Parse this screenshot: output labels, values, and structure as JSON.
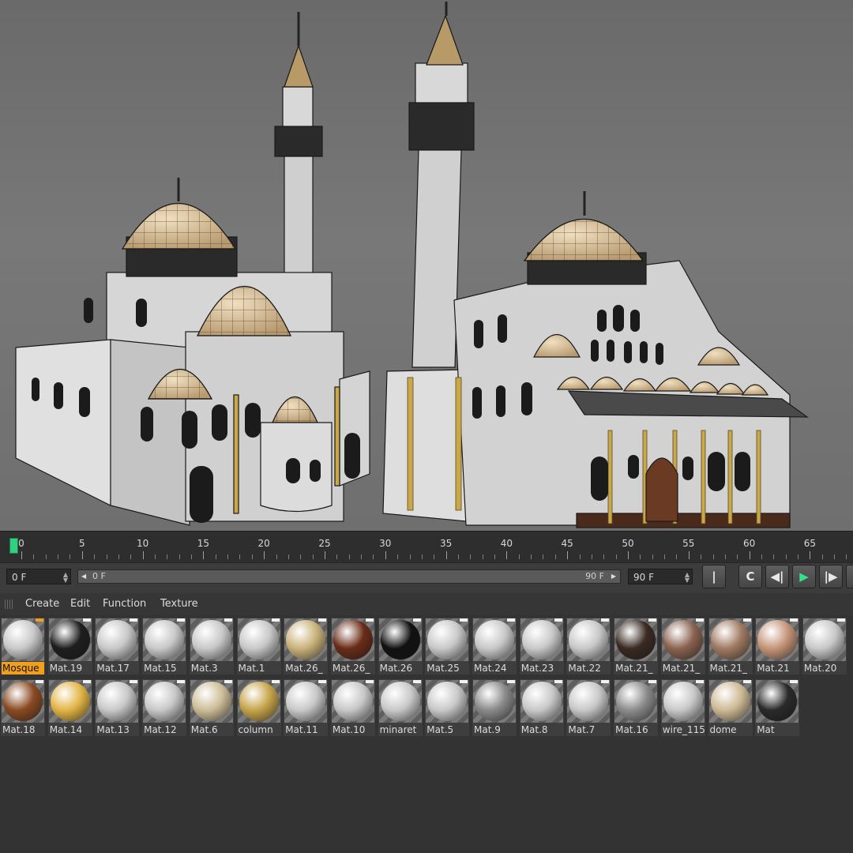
{
  "timeline": {
    "ticks": [
      "0",
      "5",
      "10",
      "15",
      "20",
      "25",
      "30",
      "35",
      "40",
      "45",
      "50",
      "55",
      "60",
      "65"
    ],
    "current_frame": 0
  },
  "transport": {
    "current_field": "0 F",
    "range_start": "0 F",
    "range_end": "90 F",
    "end_field": "90 F"
  },
  "material_menu": {
    "items": [
      "Create",
      "Edit",
      "Function",
      "Texture"
    ]
  },
  "materials": {
    "row1": [
      {
        "name": "Mosque",
        "color": "#c8c8c8",
        "selected": true
      },
      {
        "name": "Mat.19",
        "color": "#1e1e1e"
      },
      {
        "name": "Mat.17",
        "color": "#c8c8c8"
      },
      {
        "name": "Mat.15",
        "color": "#c8c8c8"
      },
      {
        "name": "Mat.3",
        "color": "#c8c8c8"
      },
      {
        "name": "Mat.1",
        "color": "#c8c8c8"
      },
      {
        "name": "Mat.26_",
        "color": "#c9b27a"
      },
      {
        "name": "Mat.26_",
        "color": "#6a2c18"
      },
      {
        "name": "Mat.26",
        "color": "#111111"
      },
      {
        "name": "Mat.25",
        "color": "#c8c8c8"
      },
      {
        "name": "Mat.24",
        "color": "#c8c8c8"
      },
      {
        "name": "Mat.23",
        "color": "#c8c8c8"
      },
      {
        "name": "Mat.22",
        "color": "#c8c8c8"
      },
      {
        "name": "Mat.21_",
        "color": "#3a2a22"
      },
      {
        "name": "Mat.21_",
        "color": "#8a6250"
      },
      {
        "name": "Mat.21_",
        "color": "#a07a62"
      },
      {
        "name": "Mat.21",
        "color": "#c49478"
      },
      {
        "name": "Mat.20",
        "color": "#c8c8c8"
      }
    ],
    "row2": [
      {
        "name": "Mat.18",
        "color": "#8a4a22"
      },
      {
        "name": "Mat.14",
        "color": "#e2b445"
      },
      {
        "name": "Mat.13",
        "color": "#c8c8c8"
      },
      {
        "name": "Mat.12",
        "color": "#c8c8c8"
      },
      {
        "name": "Mat.6",
        "color": "#cdbd98"
      },
      {
        "name": "column",
        "color": "#c6a44a"
      },
      {
        "name": "Mat.11",
        "color": "#c8c8c8"
      },
      {
        "name": "Mat.10",
        "color": "#c8c8c8"
      },
      {
        "name": "minaret",
        "color": "#c8c8c8"
      },
      {
        "name": "Mat.5",
        "color": "#c8c8c8"
      },
      {
        "name": "Mat.9",
        "color": "#8a8a8a"
      },
      {
        "name": "Mat.8",
        "color": "#c8c8c8"
      },
      {
        "name": "Mat.7",
        "color": "#c8c8c8"
      },
      {
        "name": "Mat.16",
        "color": "#8c8c8c"
      },
      {
        "name": "wire_115",
        "color": "#c8c8c8"
      },
      {
        "name": "dome",
        "color": "#cdb994"
      },
      {
        "name": "Mat",
        "color": "#2a2a2a"
      }
    ]
  },
  "colors": {
    "play_accent": "#35e08a",
    "selection": "#f0a01c",
    "dome": "#d8c29c",
    "wall": "#dcdcdc"
  }
}
